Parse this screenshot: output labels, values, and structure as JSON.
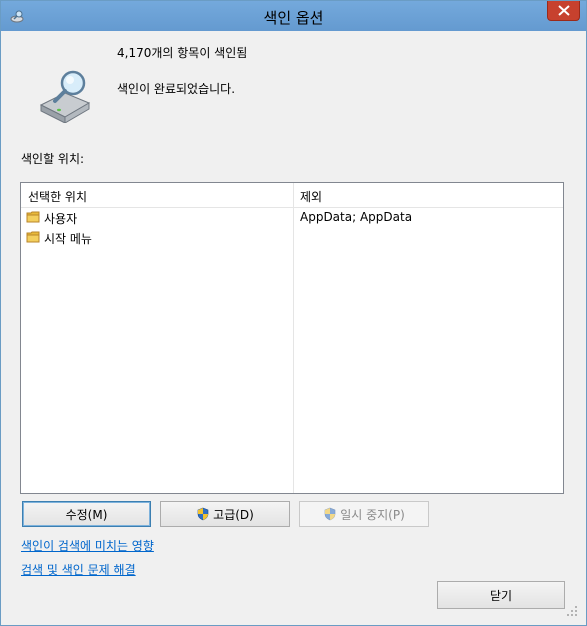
{
  "window": {
    "title": "색인 옵션"
  },
  "status": {
    "item_count": "4,170개의 항목이 색인됨",
    "message": "색인이 완료되었습니다."
  },
  "locations": {
    "label": "색인할 위치:",
    "columns": {
      "selected": "선택한 위치",
      "exclude": "제외"
    },
    "rows": [
      {
        "name": "사용자",
        "exclude": "AppData; AppData"
      },
      {
        "name": "시작 메뉴",
        "exclude": ""
      }
    ]
  },
  "buttons": {
    "modify": "수정(M)",
    "advanced": "고급(D)",
    "pause": "일시 중지(P)",
    "close": "닫기"
  },
  "links": {
    "how_affects": "색인이 검색에 미치는 영향",
    "troubleshoot": "검색 및 색인 문제 해결"
  },
  "colors": {
    "titlebar": "#6aa0d4",
    "close_button": "#c7412e",
    "link": "#0066cc",
    "folder": "#e8b93a"
  },
  "icons": {
    "title": "indexing-options-icon",
    "status": "search-drive-icon",
    "folder": "folder-icon",
    "shield": "uac-shield-icon",
    "close": "close-x-icon"
  }
}
